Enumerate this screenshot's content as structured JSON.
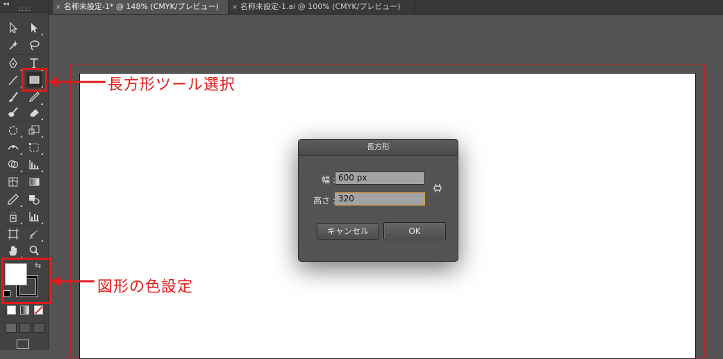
{
  "tabs": [
    {
      "label": "名称未設定-1* @ 148% (CMYK/プレビュー)",
      "active": true
    },
    {
      "label": "名称未設定-1.ai @ 100% (CMYK/プレビュー)",
      "active": false
    }
  ],
  "tab_close_glyph": "×",
  "toolbar": {
    "collapse_glyph": "◂◂",
    "tools": [
      "selection-tool",
      "direct-selection-tool",
      "magic-wand-tool",
      "lasso-tool",
      "pen-tool",
      "type-tool",
      "line-segment-tool",
      "rectangle-tool",
      "paintbrush-tool",
      "pencil-tool",
      "blob-brush-tool",
      "eraser-tool",
      "rotate-tool",
      "scale-tool",
      "width-tool",
      "free-transform-tool",
      "shape-builder-tool",
      "graph-tool",
      "mesh-tool",
      "gradient-tool",
      "eyedropper-tool",
      "blend-tool",
      "symbol-sprayer-tool",
      "column-graph-tool",
      "artboard-tool",
      "slice-tool",
      "hand-tool",
      "zoom-tool"
    ],
    "fill_color": "#ffffff",
    "stroke_color": "#000000"
  },
  "dialog": {
    "title": "長方形",
    "width_label": "幅 :",
    "width_value": "600 px",
    "height_label": "高さ :",
    "height_value": "320",
    "cancel_label": "キャンセル",
    "ok_label": "OK"
  },
  "annotations": {
    "rectangle_tool": "長方形ツール選択",
    "color_setting": "図形の色設定",
    "color": "#e11b1b"
  }
}
